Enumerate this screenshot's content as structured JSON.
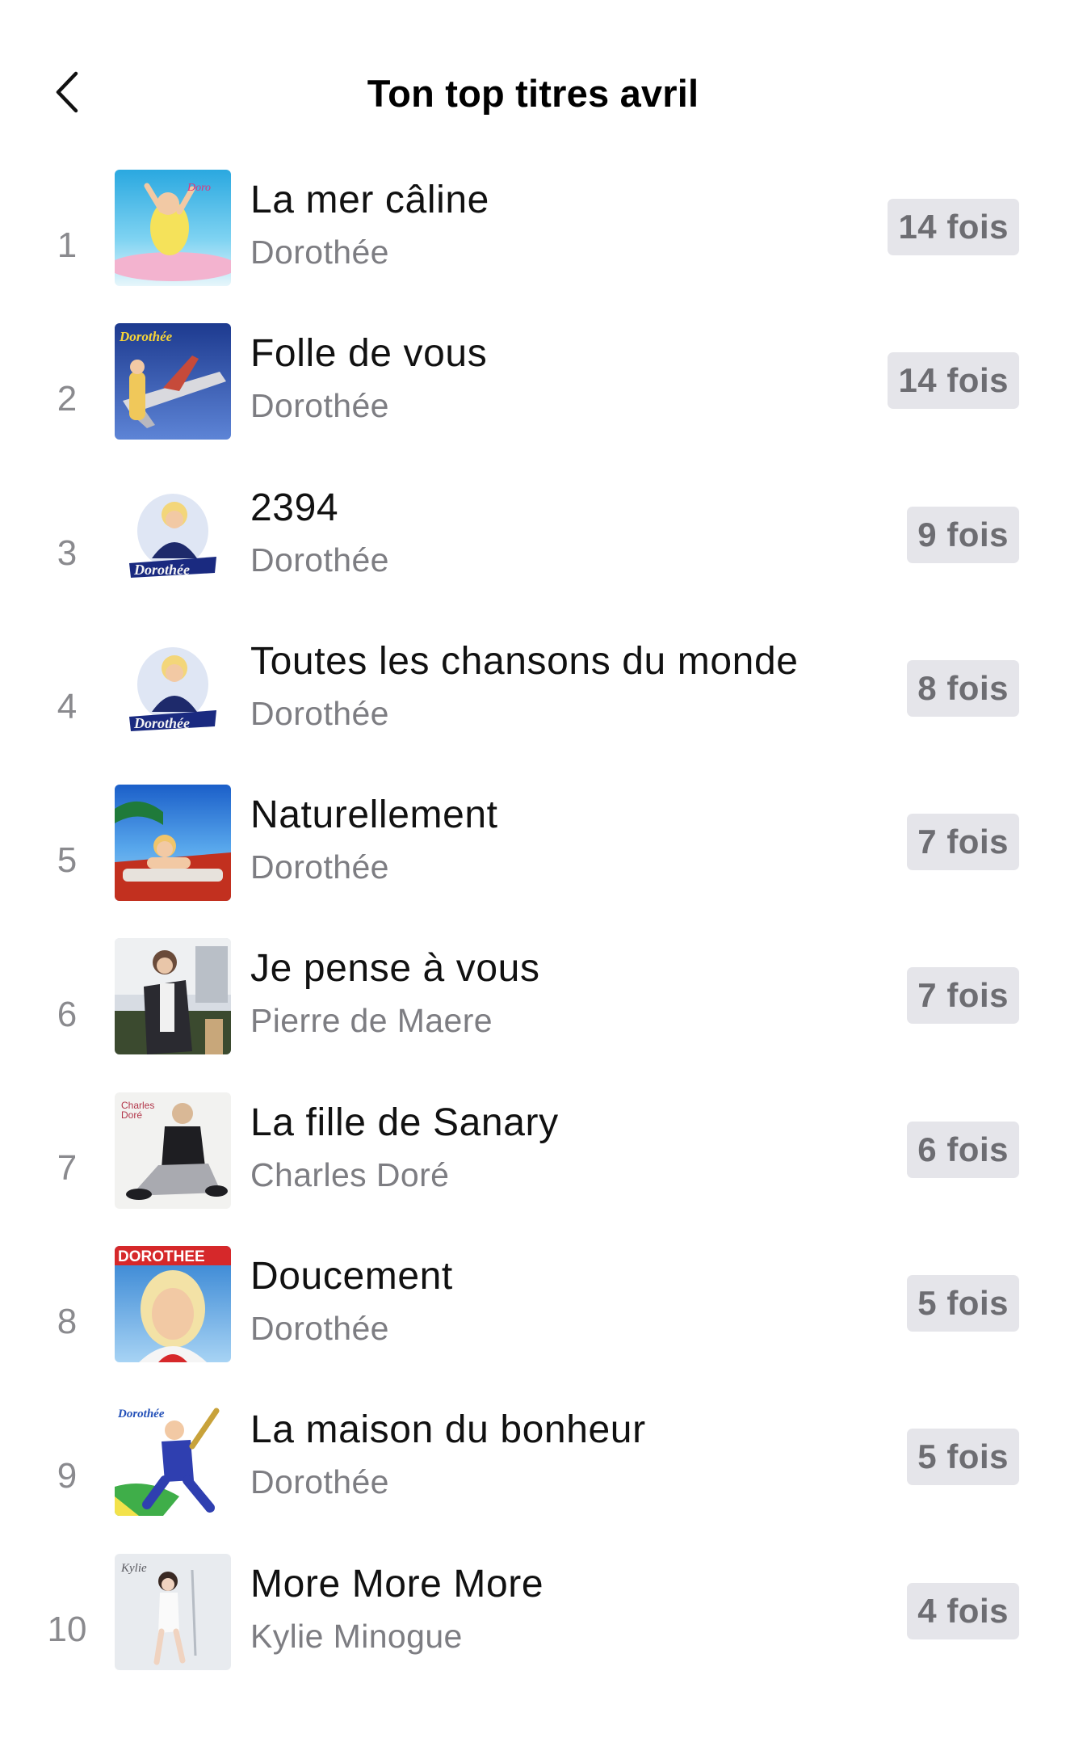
{
  "header": {
    "title": "Ton top titres avril",
    "back_icon": "chevron-left-icon"
  },
  "tracks": [
    {
      "rank": "1",
      "title": "La mer câline",
      "artist": "Dorothée",
      "plays": "14 fois"
    },
    {
      "rank": "2",
      "title": "Folle de vous",
      "artist": "Dorothée",
      "plays": "14 fois"
    },
    {
      "rank": "3",
      "title": "2394",
      "artist": "Dorothée",
      "plays": "9 fois"
    },
    {
      "rank": "4",
      "title": "Toutes les chansons du monde",
      "artist": "Dorothée",
      "plays": "8 fois"
    },
    {
      "rank": "5",
      "title": "Naturellement",
      "artist": "Dorothée",
      "plays": "7 fois"
    },
    {
      "rank": "6",
      "title": "Je pense à vous",
      "artist": "Pierre de Maere",
      "plays": "7 fois"
    },
    {
      "rank": "7",
      "title": "La fille de Sanary",
      "artist": "Charles Doré",
      "plays": "6 fois"
    },
    {
      "rank": "8",
      "title": "Doucement",
      "artist": "Dorothée",
      "plays": "5 fois"
    },
    {
      "rank": "9",
      "title": "La maison du bonheur",
      "artist": "Dorothée",
      "plays": "5 fois"
    },
    {
      "rank": "10",
      "title": "More More More",
      "artist": "Kylie Minogue",
      "plays": "4 fois"
    }
  ],
  "colors": {
    "background": "#ffffff",
    "title": "#000000",
    "song_title": "#111111",
    "secondary": "#7d7d82",
    "badge_bg": "#e5e5ea",
    "badge_text": "#6d6d72"
  }
}
